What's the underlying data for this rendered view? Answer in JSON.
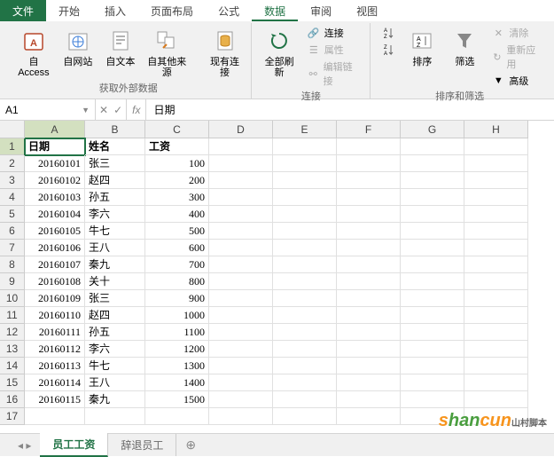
{
  "menu": {
    "file": "文件",
    "tabs": [
      "开始",
      "插入",
      "页面布局",
      "公式",
      "数据",
      "审阅",
      "视图"
    ],
    "active_index": 4
  },
  "ribbon": {
    "group1": {
      "label": "获取外部数据",
      "access": "自 Access",
      "web": "自网站",
      "text": "自文本",
      "other": "自其他来源",
      "existing": "现有连接"
    },
    "group2": {
      "label": "连接",
      "refresh": "全部刷新",
      "conn": "连接",
      "prop": "属性",
      "editlink": "编辑链接"
    },
    "group3": {
      "label": "排序和筛选",
      "sort_asc": "A→Z",
      "sort_desc": "Z→A",
      "sort": "排序",
      "filter": "筛选",
      "clear": "清除",
      "reapply": "重新应用",
      "advanced": "高级"
    }
  },
  "namebox": "A1",
  "formula": "日期",
  "columns": [
    "A",
    "B",
    "C",
    "D",
    "E",
    "F",
    "G",
    "H"
  ],
  "headers": {
    "A": "日期",
    "B": "姓名",
    "C": "工资"
  },
  "chart_data": {
    "type": "table",
    "title": "员工工资",
    "columns": [
      "日期",
      "姓名",
      "工资"
    ],
    "rows": [
      {
        "日期": 20160101,
        "姓名": "张三",
        "工资": 100
      },
      {
        "日期": 20160102,
        "姓名": "赵四",
        "工资": 200
      },
      {
        "日期": 20160103,
        "姓名": "孙五",
        "工资": 300
      },
      {
        "日期": 20160104,
        "姓名": "李六",
        "工资": 400
      },
      {
        "日期": 20160105,
        "姓名": "牛七",
        "工资": 500
      },
      {
        "日期": 20160106,
        "姓名": "王八",
        "工资": 600
      },
      {
        "日期": 20160107,
        "姓名": "秦九",
        "工资": 700
      },
      {
        "日期": 20160108,
        "姓名": "关十",
        "工资": 800
      },
      {
        "日期": 20160109,
        "姓名": "张三",
        "工资": 900
      },
      {
        "日期": 20160110,
        "姓名": "赵四",
        "工资": 1000
      },
      {
        "日期": 20160111,
        "姓名": "孙五",
        "工资": 1100
      },
      {
        "日期": 20160112,
        "姓名": "李六",
        "工资": 1200
      },
      {
        "日期": 20160113,
        "姓名": "牛七",
        "工资": 1300
      },
      {
        "日期": 20160114,
        "姓名": "王八",
        "工资": 1400
      },
      {
        "日期": 20160115,
        "姓名": "秦九",
        "工资": 1500
      }
    ]
  },
  "sheets": {
    "active": "员工工资",
    "other": "辞退员工"
  },
  "watermark": {
    "s": "s",
    "han": "han",
    "cun": "cun",
    "sub": "山村脚本"
  }
}
